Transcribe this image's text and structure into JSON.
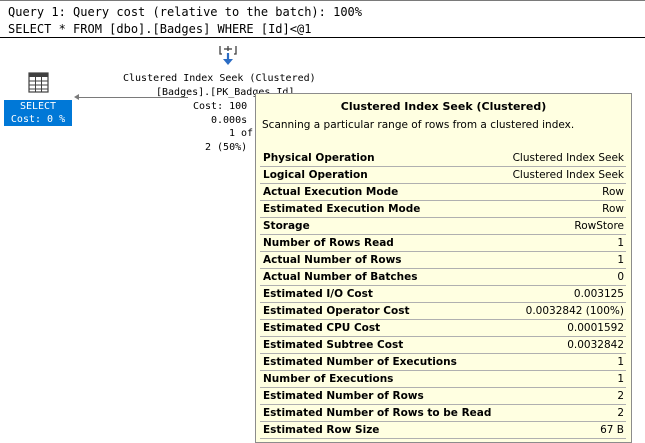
{
  "query_header": {
    "line1": "Query 1: Query cost (relative to the batch): 100%",
    "line2": "SELECT * FROM [dbo].[Badges] WHERE [Id]<@1"
  },
  "select_node": {
    "label_line1": "SELECT",
    "label_line2": "Cost: 0 %",
    "icon": "table-grid-icon"
  },
  "seek_node": {
    "icon": "index-seek-icon",
    "name": "Clustered Index Seek (Clustered)",
    "object": "[Badges].[PK_Badges_Id]",
    "cost": "Cost: 100",
    "time": "0.000s",
    "rows": "1 of",
    "estimate": "2 (50%)"
  },
  "tooltip": {
    "title": "Clustered Index Seek (Clustered)",
    "description": "Scanning a particular range of rows from a clustered index.",
    "rows": [
      {
        "key": "Physical Operation",
        "value": "Clustered Index Seek"
      },
      {
        "key": "Logical Operation",
        "value": "Clustered Index Seek"
      },
      {
        "key": "Actual Execution Mode",
        "value": "Row"
      },
      {
        "key": "Estimated Execution Mode",
        "value": "Row"
      },
      {
        "key": "Storage",
        "value": "RowStore"
      },
      {
        "key": "Number of Rows Read",
        "value": "1"
      },
      {
        "key": "Actual Number of Rows",
        "value": "1"
      },
      {
        "key": "Actual Number of Batches",
        "value": "0"
      },
      {
        "key": "Estimated I/O Cost",
        "value": "0.003125"
      },
      {
        "key": "Estimated Operator Cost",
        "value": "0.0032842 (100%)"
      },
      {
        "key": "Estimated CPU Cost",
        "value": "0.0001592"
      },
      {
        "key": "Estimated Subtree Cost",
        "value": "0.0032842"
      },
      {
        "key": "Estimated Number of Executions",
        "value": "1"
      },
      {
        "key": "Number of Executions",
        "value": "1"
      },
      {
        "key": "Estimated Number of Rows",
        "value": "2"
      },
      {
        "key": "Estimated Number of Rows to be Read",
        "value": "2"
      },
      {
        "key": "Estimated Row Size",
        "value": "67 B"
      }
    ]
  },
  "colors": {
    "select_highlight": "#0078d7",
    "tooltip_bg": "#ffffe1",
    "icon_blue": "#2b6cc4"
  }
}
